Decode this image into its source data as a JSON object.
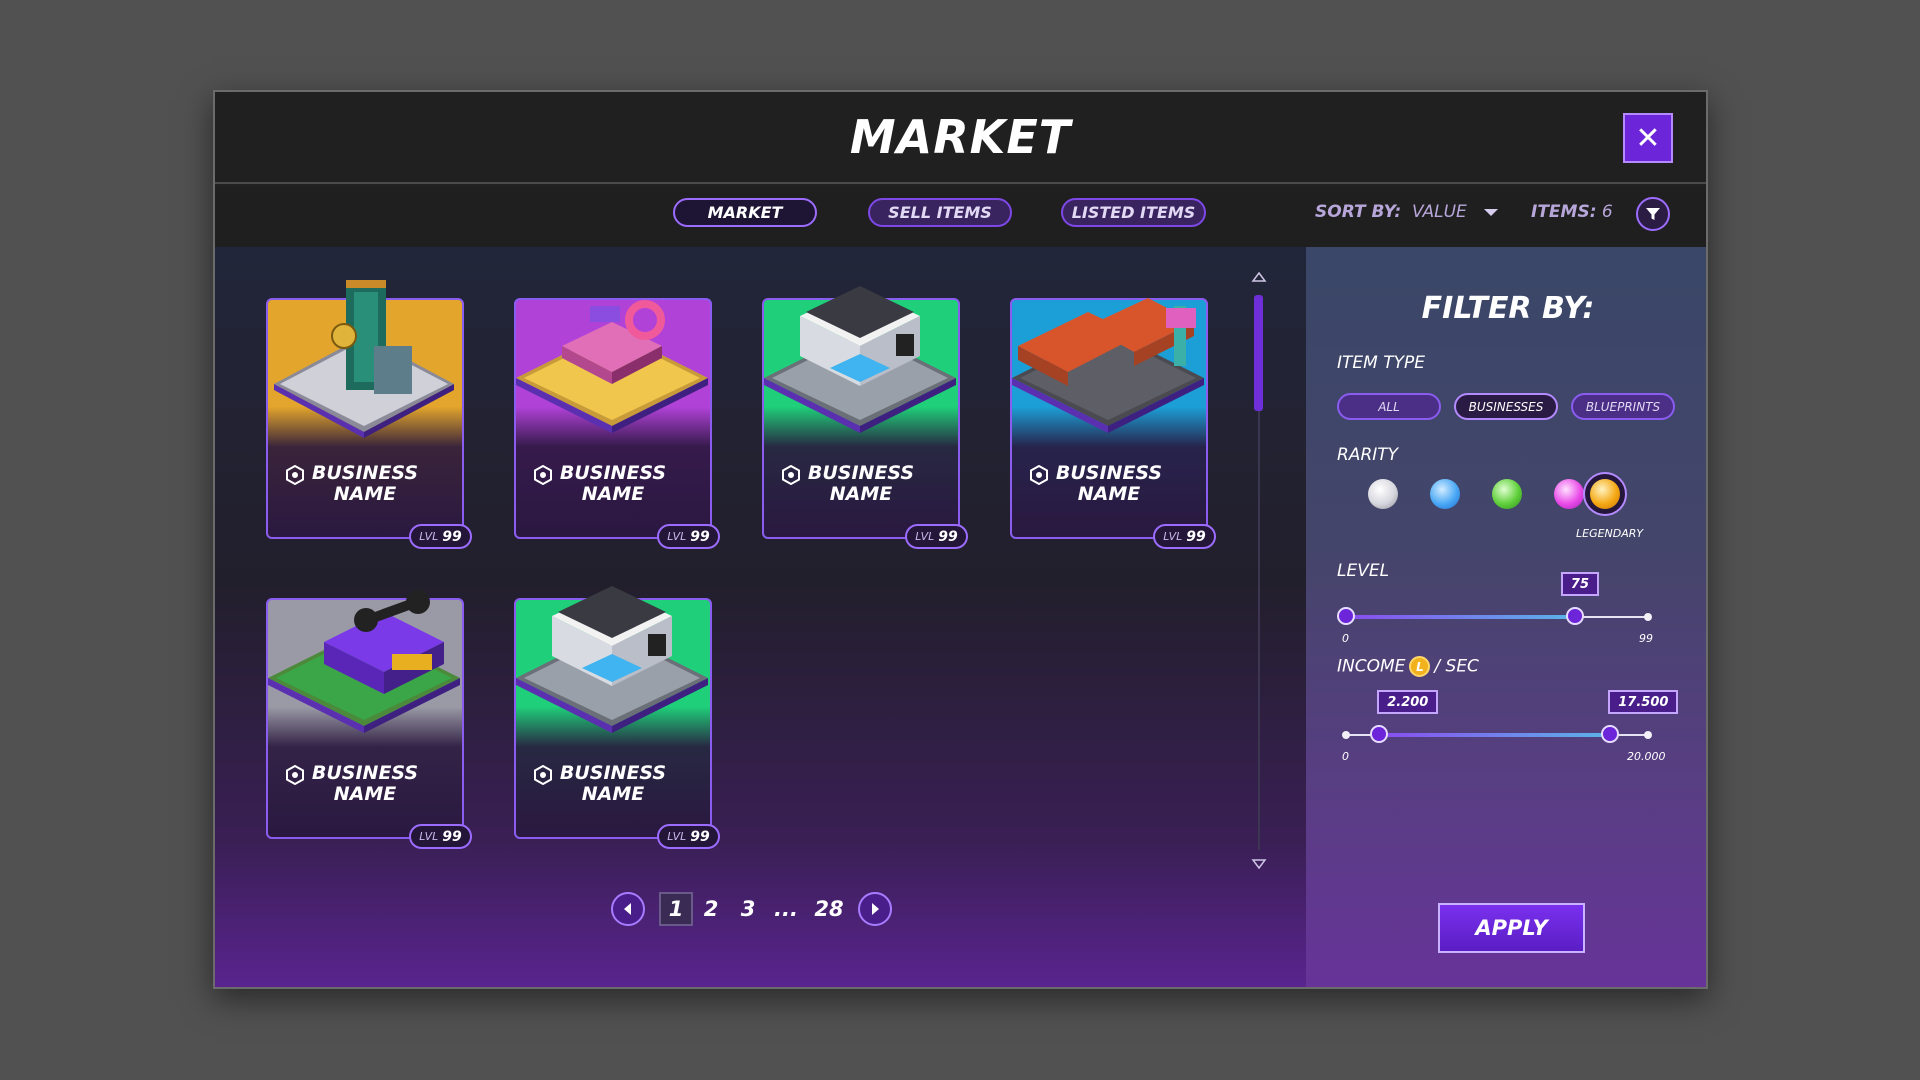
{
  "header": {
    "title": "MARKET",
    "close_label": "✕"
  },
  "tabs": [
    {
      "label": "MARKET",
      "active": true
    },
    {
      "label": "SELL ITEMS",
      "active": false
    },
    {
      "label": "LISTED ITEMS",
      "active": false
    }
  ],
  "sort": {
    "prefix": "SORT BY:",
    "value": "VALUE"
  },
  "items": {
    "prefix": "ITEMS:",
    "count": "6"
  },
  "cards": [
    {
      "name_line1": "BUSINESS",
      "name_line2": "NAME",
      "lvl_prefix": "LVL",
      "level": "99",
      "bg": "#e3a52b",
      "icon": "casino-tower-building"
    },
    {
      "name_line1": "BUSINESS",
      "name_line2": "NAME",
      "lvl_prefix": "LVL",
      "level": "99",
      "bg": "#b142d8",
      "icon": "donut-shop-building"
    },
    {
      "name_line1": "BUSINESS",
      "name_line2": "NAME",
      "lvl_prefix": "LVL",
      "level": "99",
      "bg": "#1fcf7a",
      "icon": "hotel-building"
    },
    {
      "name_line1": "BUSINESS",
      "name_line2": "NAME",
      "lvl_prefix": "LVL",
      "level": "99",
      "bg": "#1c9fd6",
      "icon": "motel-building"
    },
    {
      "name_line1": "BUSINESS",
      "name_line2": "NAME",
      "lvl_prefix": "LVL",
      "level": "99",
      "bg": "#9a9aa6",
      "icon": "gym-building"
    },
    {
      "name_line1": "BUSINESS",
      "name_line2": "NAME",
      "lvl_prefix": "LVL",
      "level": "99",
      "bg": "#1fcf7a",
      "icon": "hotel-building"
    }
  ],
  "pagination": {
    "pages": [
      "1",
      "2",
      "3",
      "...",
      "28"
    ],
    "current": "1"
  },
  "filter": {
    "title": "FILTER BY:",
    "item_type_label": "ITEM TYPE",
    "item_types": [
      {
        "label": "ALL",
        "active": false
      },
      {
        "label": "BUSINESSES",
        "active": true
      },
      {
        "label": "BLUEPRINTS",
        "active": false
      }
    ],
    "rarity_label": "RARITY",
    "rarities": [
      {
        "name": "common",
        "color": "#d6d6de"
      },
      {
        "name": "rare",
        "color": "#4aa8f5"
      },
      {
        "name": "uncommon",
        "color": "#5fcf3a"
      },
      {
        "name": "epic",
        "color": "#e94be8"
      },
      {
        "name": "legendary",
        "color": "#f5a814"
      }
    ],
    "selected_rarity_label": "LEGENDARY",
    "level_label": "LEVEL",
    "level": {
      "min": "0",
      "max": "99",
      "value": "75",
      "value_fraction": 0.758
    },
    "income_label_prefix": "INCOME",
    "income_label_suffix": "/ SEC",
    "income": {
      "min": "0",
      "max": "20.000",
      "low": "2.200",
      "high": "17.500",
      "low_fraction": 0.11,
      "high_fraction": 0.875
    },
    "apply_label": "APPLY"
  }
}
